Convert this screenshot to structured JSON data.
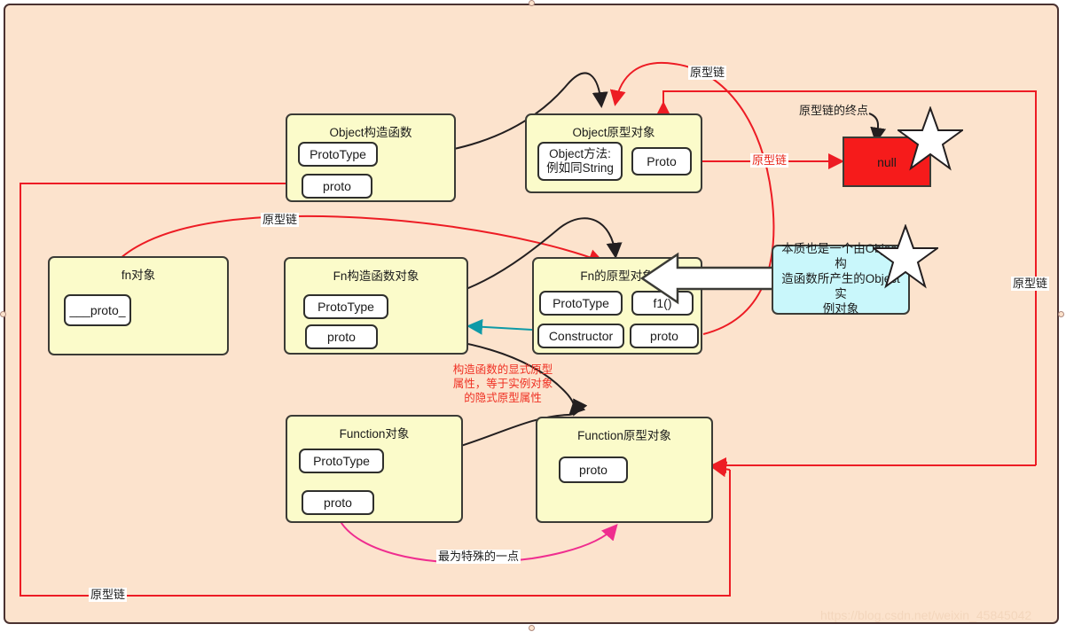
{
  "diagram": {
    "background_color": "#fce3cd",
    "frame_border_color": "#4a3231",
    "node_fill": "#fbfbca",
    "slot_fill": "#ffffff",
    "null_fill": "#f61b1b",
    "note_fill": "#c9f7fb",
    "red_link_color": "#ed1c24",
    "black_link_color": "#231f20",
    "teal_link_color": "#0e9aa7",
    "pink_link_color": "#ef2d8f",
    "watermark": "https://blog.csdn.net/weixin_45845042"
  },
  "nodes": {
    "object_ctor": {
      "title": "Object构造函数",
      "slots": [
        {
          "label": "ProtoType"
        },
        {
          "label": "proto"
        }
      ]
    },
    "object_proto": {
      "title": "Object原型对象",
      "slots": [
        {
          "label": "Object方法:",
          "label2": "例如同String"
        },
        {
          "label": "Proto"
        }
      ]
    },
    "fn_instance": {
      "title": "fn对象",
      "slots": [
        {
          "label": "___proto_"
        }
      ]
    },
    "fn_ctor": {
      "title": "Fn构造函数对象",
      "slots": [
        {
          "label": "ProtoType"
        },
        {
          "label": "proto"
        }
      ]
    },
    "fn_proto": {
      "title": "Fn的原型对象",
      "slots": [
        {
          "label": "ProtoType"
        },
        {
          "label": "f1()"
        },
        {
          "label": "Constructor"
        },
        {
          "label": "proto"
        }
      ]
    },
    "function_obj": {
      "title": "Function对象",
      "slots": [
        {
          "label": "ProtoType"
        },
        {
          "label": "proto"
        }
      ]
    },
    "function_proto": {
      "title": "Function原型对象",
      "slots": [
        {
          "label": "proto"
        }
      ]
    },
    "null_node": {
      "label": "null"
    },
    "note_object_instance": {
      "text_lines": [
        "本质也是一个由Object构",
        "造函数所产生的Object实",
        "例对象"
      ]
    }
  },
  "labels": {
    "chain_top": "原型链",
    "chain_to_null": "原型链",
    "chain_end_title": "原型链的终点",
    "chain_left_mid": "原型链",
    "chain_right": "原型链",
    "chain_bottom": "原型链",
    "explicit_proto_note": [
      "构造函数的显式原型",
      "属性，等于实例对象",
      "的隐式原型属性"
    ],
    "most_special": "最为特殊的一点"
  }
}
